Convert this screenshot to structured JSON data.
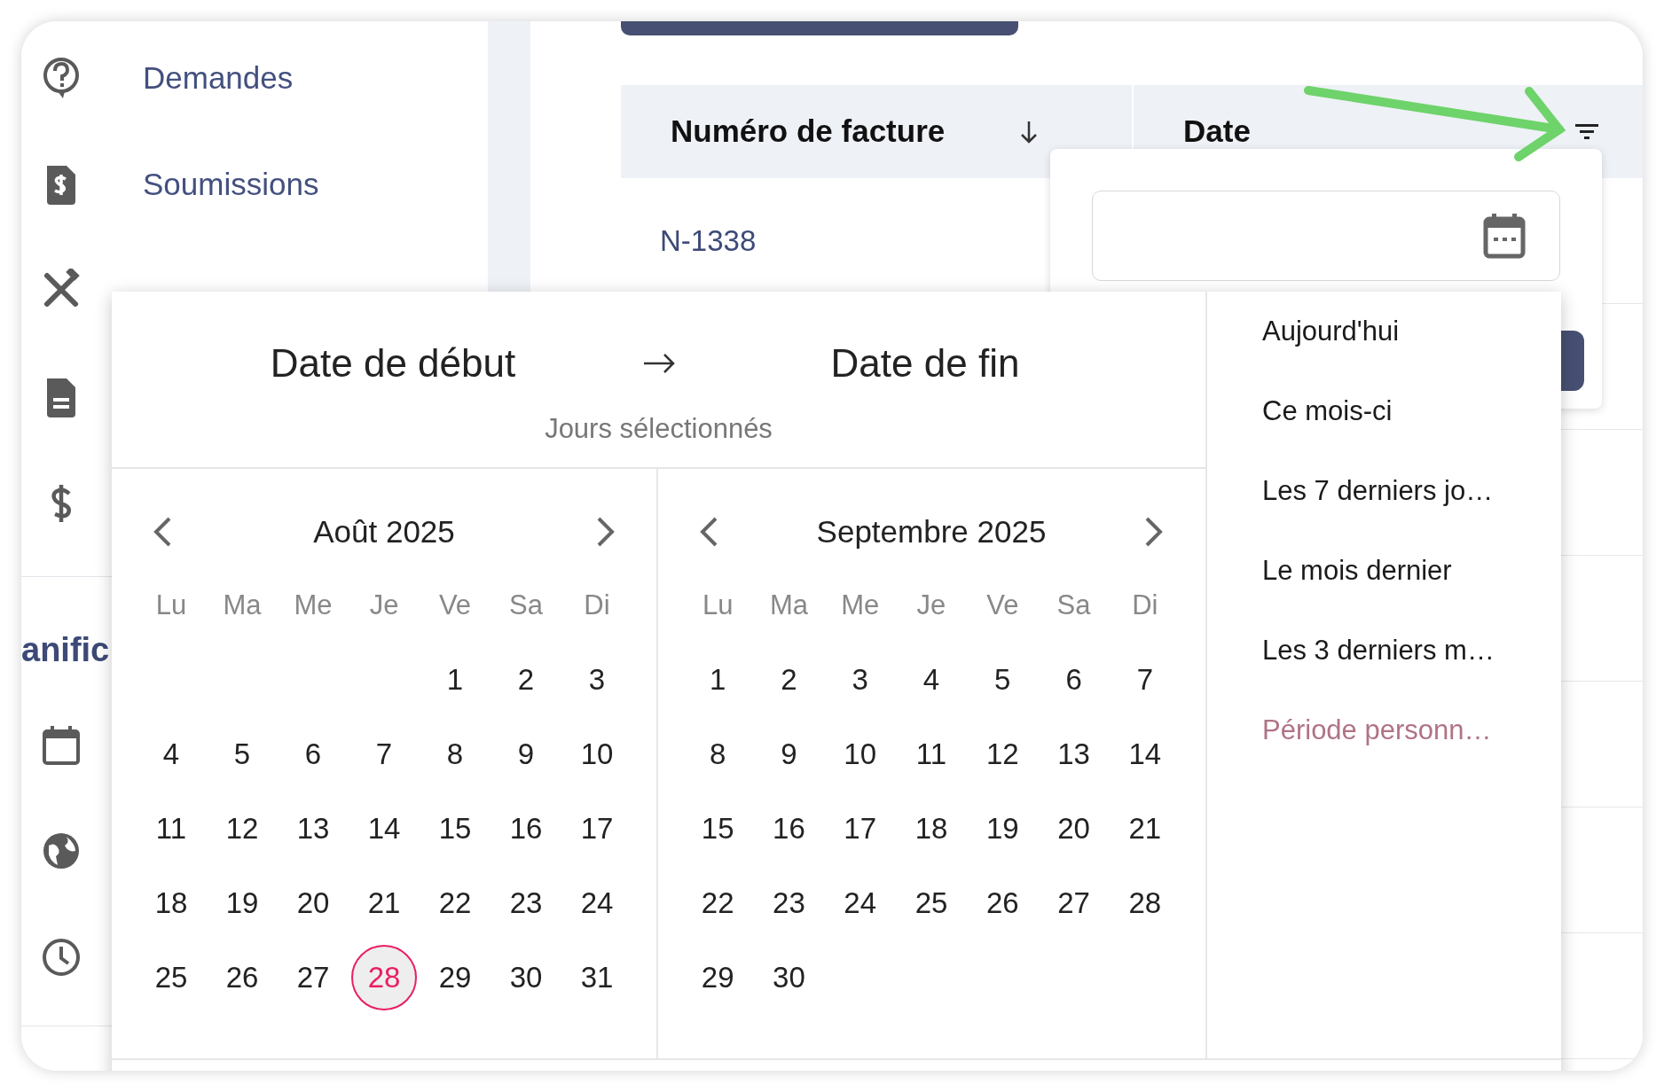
{
  "sidebar": {
    "items": [
      {
        "label": "Demandes"
      },
      {
        "label": "Soumissions"
      }
    ],
    "section_label": "anific"
  },
  "table": {
    "columns": [
      {
        "label": "Numéro de facture",
        "sorted": true,
        "filter": false
      },
      {
        "label": "Date",
        "sorted": false,
        "filter": true
      }
    ],
    "rows": [
      [
        "N-1338"
      ]
    ]
  },
  "date_picker": {
    "start_label": "Date de début",
    "end_label": "Date de fin",
    "hint": "Jours sélectionnés",
    "months": [
      {
        "title": "Août 2025",
        "weekdays": [
          "Lu",
          "Ma",
          "Me",
          "Je",
          "Ve",
          "Sa",
          "Di"
        ],
        "weeks": [
          [
            {
              "label": "1",
              "today": false
            },
            {
              "label": "2",
              "today": false
            },
            {
              "label": "3",
              "today": false
            }
          ],
          [
            {
              "label": "4",
              "today": false
            },
            {
              "label": "5",
              "today": false
            },
            {
              "label": "6",
              "today": false
            },
            {
              "label": "7",
              "today": false
            },
            {
              "label": "8",
              "today": false
            },
            {
              "label": "9",
              "today": false
            },
            {
              "label": "10",
              "today": false
            }
          ],
          [
            {
              "label": "11",
              "today": false
            },
            {
              "label": "12",
              "today": false
            },
            {
              "label": "13",
              "today": false
            },
            {
              "label": "14",
              "today": false
            },
            {
              "label": "15",
              "today": false
            },
            {
              "label": "16",
              "today": false
            },
            {
              "label": "17",
              "today": false
            }
          ],
          [
            {
              "label": "18",
              "today": false
            },
            {
              "label": "19",
              "today": false
            },
            {
              "label": "20",
              "today": false
            },
            {
              "label": "21",
              "today": false
            },
            {
              "label": "22",
              "today": false
            },
            {
              "label": "23",
              "today": false
            },
            {
              "label": "24",
              "today": false
            }
          ],
          [
            {
              "label": "25",
              "today": false
            },
            {
              "label": "26",
              "today": false
            },
            {
              "label": "27",
              "today": false
            },
            {
              "label": "28",
              "today": true
            },
            {
              "label": "29",
              "today": false
            },
            {
              "label": "30",
              "today": false
            },
            {
              "label": "31",
              "today": false
            }
          ]
        ]
      },
      {
        "title": "Septembre 2025",
        "weekdays": [
          "Lu",
          "Ma",
          "Me",
          "Je",
          "Ve",
          "Sa",
          "Di"
        ],
        "weeks": [
          [
            {
              "label": "1",
              "today": false
            },
            {
              "label": "2",
              "today": false
            },
            {
              "label": "3",
              "today": false
            },
            {
              "label": "4",
              "today": false
            },
            {
              "label": "5",
              "today": false
            },
            {
              "label": "6",
              "today": false
            },
            {
              "label": "7",
              "today": false
            }
          ],
          [
            {
              "label": "8",
              "today": false
            },
            {
              "label": "9",
              "today": false
            },
            {
              "label": "10",
              "today": false
            },
            {
              "label": "11",
              "today": false
            },
            {
              "label": "12",
              "today": false
            },
            {
              "label": "13",
              "today": false
            },
            {
              "label": "14",
              "today": false
            }
          ],
          [
            {
              "label": "15",
              "today": false
            },
            {
              "label": "16",
              "today": false
            },
            {
              "label": "17",
              "today": false
            },
            {
              "label": "18",
              "today": false
            },
            {
              "label": "19",
              "today": false
            },
            {
              "label": "20",
              "today": false
            },
            {
              "label": "21",
              "today": false
            }
          ],
          [
            {
              "label": "22",
              "today": false
            },
            {
              "label": "23",
              "today": false
            },
            {
              "label": "24",
              "today": false
            },
            {
              "label": "25",
              "today": false
            },
            {
              "label": "26",
              "today": false
            },
            {
              "label": "27",
              "today": false
            },
            {
              "label": "28",
              "today": false
            }
          ],
          [
            {
              "label": "29",
              "today": false
            },
            {
              "label": "30",
              "today": false
            }
          ]
        ]
      }
    ],
    "presets": [
      {
        "label": "Aujourd'hui",
        "selected": false
      },
      {
        "label": "Ce mois-ci",
        "selected": false
      },
      {
        "label": "Les 7 derniers jo…",
        "selected": false
      },
      {
        "label": "Le mois dernier",
        "selected": false
      },
      {
        "label": "Les 3 derniers m…",
        "selected": false
      },
      {
        "label": "Période personn…",
        "selected": true
      }
    ]
  }
}
